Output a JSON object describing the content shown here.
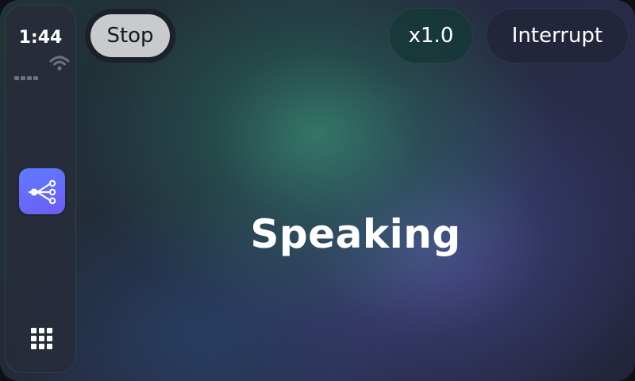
{
  "status_bar": {
    "time": "1:44",
    "signal_icon": "cellular-signal-icon",
    "wifi_icon": "wifi-icon"
  },
  "dock": {
    "apps": [
      {
        "name": "workflow-app",
        "icon": "branch-tree-icon",
        "color": "#5e7cff"
      }
    ],
    "launcher_icon": "app-grid-icon"
  },
  "controls": {
    "stop_label": "Stop",
    "speed_label": "x1.0",
    "interrupt_label": "Interrupt"
  },
  "main": {
    "status_text": "Speaking"
  },
  "colors": {
    "accent": "#5e7cff",
    "stop_bg": "#c9cacd",
    "speed_bg": "#163737"
  }
}
